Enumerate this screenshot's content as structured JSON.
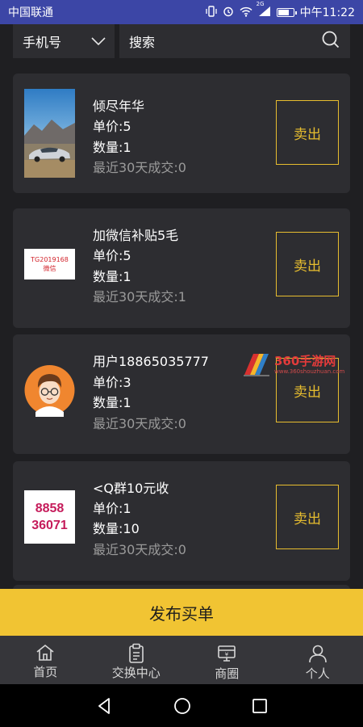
{
  "status_bar": {
    "carrier": "中国联通",
    "network": "2G",
    "time": "中午11:22"
  },
  "search": {
    "field_type": "手机号",
    "placeholder": "搜索"
  },
  "listings": [
    {
      "title": "倾尽年华",
      "price": "单价:5",
      "quantity": "数量:1",
      "recent": "最近30天成交:0",
      "action": "卖出",
      "thumb": "car-photo"
    },
    {
      "title": "加微信补贴5毛",
      "price": "单价:5",
      "quantity": "数量:1",
      "recent": "最近30天成交:1",
      "action": "卖出",
      "thumb": "text-label",
      "thumb_lines": [
        "TG2019168",
        "微信"
      ]
    },
    {
      "title": "用户18865035777",
      "price": "单价:3",
      "quantity": "数量:1",
      "recent": "最近30天成交:0",
      "action": "卖出",
      "thumb": "avatar-cartoon"
    },
    {
      "title": "<Q群10元收",
      "price": "单价:1",
      "quantity": "数量:10",
      "recent": "最近30天成交:0",
      "action": "卖出",
      "thumb": "qq-number",
      "thumb_lines": [
        "8858",
        "36071"
      ]
    }
  ],
  "watermark": {
    "title": "360手游网",
    "subtitle": "www.360shouzhuan.com"
  },
  "publish_button": "发布买单",
  "tabs": [
    {
      "label": "首页",
      "icon": "home-icon"
    },
    {
      "label": "交换中心",
      "icon": "clipboard-icon"
    },
    {
      "label": "商圈",
      "icon": "shop-icon"
    },
    {
      "label": "个人",
      "icon": "user-icon"
    }
  ],
  "colors": {
    "status_bar": "#3c46a6",
    "background": "#1f1f22",
    "card": "#2d2d31",
    "accent": "#e7bd2f",
    "publish": "#f1c433"
  }
}
